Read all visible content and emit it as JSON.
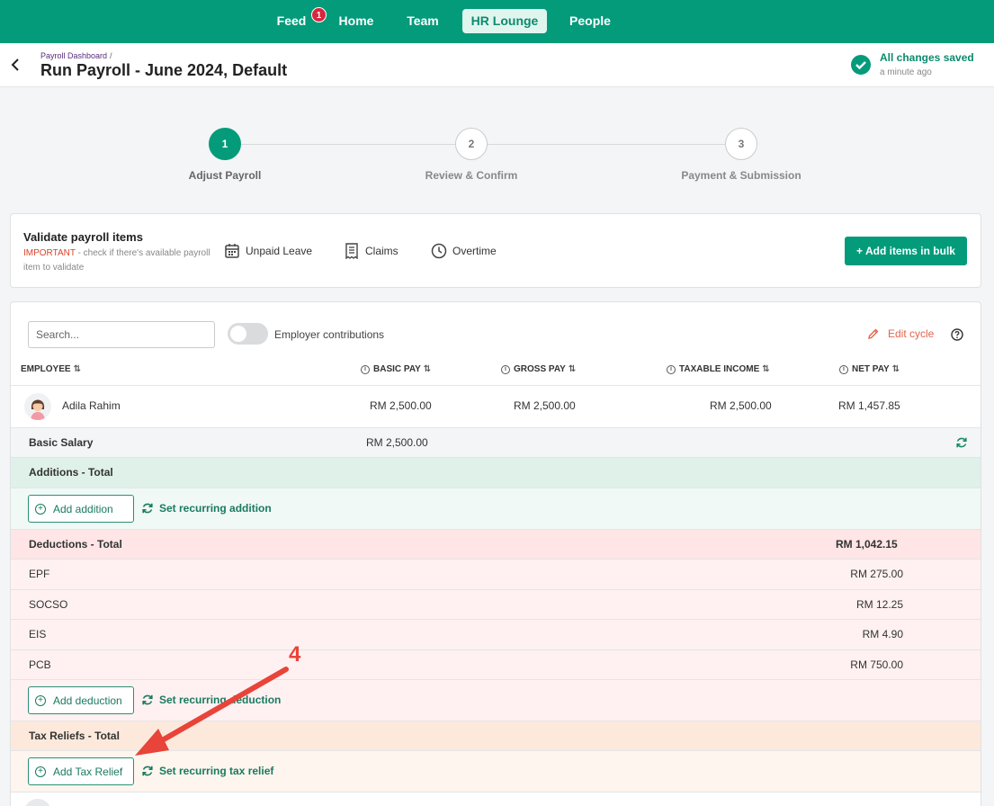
{
  "nav": {
    "feed": "Feed",
    "feed_badge": "1",
    "home": "Home",
    "team": "Team",
    "hr_lounge": "HR Lounge",
    "people": "People"
  },
  "header": {
    "breadcrumb": "Payroll Dashboard",
    "breadcrumb_sep": "/",
    "title": "Run Payroll - June 2024, Default",
    "saved_status": "All changes saved",
    "saved_time": "a minute ago"
  },
  "stepper": [
    {
      "num": "1",
      "label": "Adjust Payroll",
      "active": true
    },
    {
      "num": "2",
      "label": "Review & Confirm",
      "active": false
    },
    {
      "num": "3",
      "label": "Payment & Submission",
      "active": false
    }
  ],
  "validate": {
    "title": "Validate payroll items",
    "important": "IMPORTANT",
    "note": " - check if there's available payroll item to validate",
    "unpaid_leave": "Unpaid Leave",
    "claims": "Claims",
    "overtime": "Overtime",
    "bulk_button": "+ Add items in bulk"
  },
  "table": {
    "search_placeholder": "Search...",
    "toggle_label": "Employer contributions",
    "edit_cycle": "Edit cycle",
    "columns": {
      "employee": "EMPLOYEE",
      "basic_pay": "BASIC PAY",
      "gross_pay": "GROSS PAY",
      "taxable_income": "TAXABLE INCOME",
      "net_pay": "NET PAY"
    },
    "employee": {
      "name": "Adila Rahim",
      "basic_pay": "RM 2,500.00",
      "gross_pay": "RM 2,500.00",
      "taxable_income": "RM 2,500.00",
      "net_pay": "RM 1,457.85"
    },
    "basic_salary": {
      "label": "Basic Salary",
      "value": "RM 2,500.00"
    },
    "additions": {
      "title": "Additions - Total",
      "add_button": "Add addition",
      "recurring": "Set recurring addition"
    },
    "deductions": {
      "title": "Deductions - Total",
      "total": "RM 1,042.15",
      "items": [
        {
          "label": "EPF",
          "value": "RM 275.00"
        },
        {
          "label": "SOCSO",
          "value": "RM 12.25"
        },
        {
          "label": "EIS",
          "value": "RM 4.90"
        },
        {
          "label": "PCB",
          "value": "RM 750.00"
        }
      ],
      "add_button": "Add deduction",
      "recurring": "Set recurring deduction"
    },
    "tax_reliefs": {
      "title": "Tax Reliefs - Total",
      "add_button": "Add Tax Relief",
      "recurring": "Set recurring tax relief"
    }
  },
  "annotation": {
    "step_number": "4",
    "color": "#e8443a"
  },
  "colors": {
    "primary": "#049b7b",
    "addition_bg": "#f0f9f5",
    "addition_header": "#dff1e9",
    "deduction_bg": "#fff1f1",
    "deduction_header": "#ffe5e5",
    "relief_bg": "#fdf5ee",
    "relief_header": "#fde9dc"
  }
}
